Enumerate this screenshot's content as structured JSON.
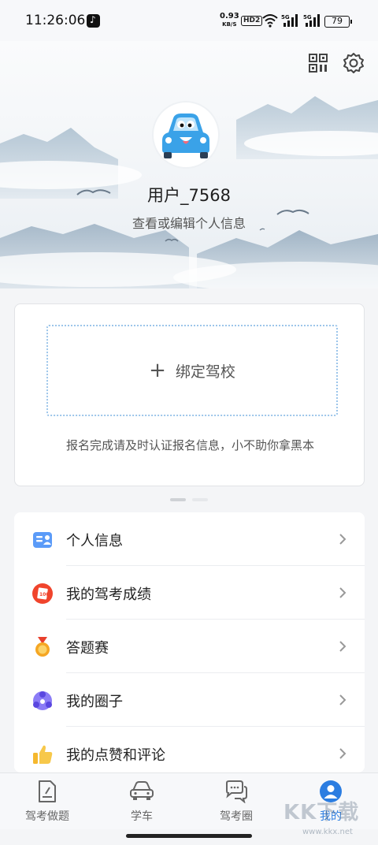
{
  "status_bar": {
    "time": "11:26:06",
    "net_speed_value": "0.93",
    "net_speed_unit": "KB/S",
    "hd_label": "HD2",
    "signal_1_label": "5G",
    "signal_2_label": "5G",
    "battery_level": "79"
  },
  "profile": {
    "username": "用户_7568",
    "edit_prompt": "查看或编辑个人信息"
  },
  "bind_card": {
    "button_label": "绑定驾校",
    "hint": "报名完成请及时认证报名信息，小不助你拿黑本"
  },
  "pager": {
    "total": 2,
    "active_index": 0
  },
  "menu": {
    "items": [
      {
        "label": "个人信息",
        "icon": "id-card-icon",
        "color": "#4d8df6"
      },
      {
        "label": "我的驾考成绩",
        "icon": "score-report-icon",
        "color": "#f0442c"
      },
      {
        "label": "答题赛",
        "icon": "medal-icon",
        "color": "#f5a623"
      },
      {
        "label": "我的圈子",
        "icon": "circle-group-icon",
        "color": "#6b5cf2"
      },
      {
        "label": "我的点赞和评论",
        "icon": "thumbs-up-icon",
        "color": "#f5b82e"
      }
    ]
  },
  "bottom_nav": {
    "items": [
      {
        "label": "驾考做题",
        "icon": "exam-paper-icon"
      },
      {
        "label": "学车",
        "icon": "car-icon"
      },
      {
        "label": "驾考圈",
        "icon": "chat-bubbles-icon"
      },
      {
        "label": "我的",
        "icon": "user-profile-icon",
        "active": true
      }
    ]
  },
  "watermark": {
    "text": "KK下载",
    "url": "www.kkx.net"
  },
  "colors": {
    "accent": "#2b7de1",
    "dotted_border": "#9cc5ea"
  }
}
